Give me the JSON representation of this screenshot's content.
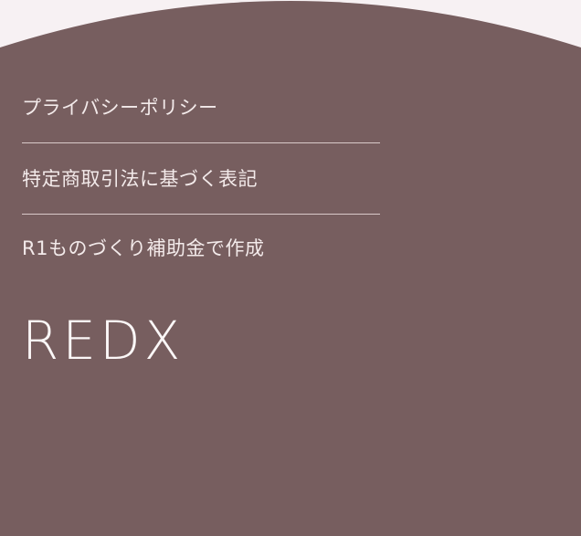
{
  "footer": {
    "links": [
      {
        "label": "プライバシーポリシー"
      },
      {
        "label": "特定商取引法に基づく表記"
      },
      {
        "label": "R1ものづくり補助金で作成"
      }
    ],
    "logo_text": "REDX"
  },
  "colors": {
    "page_background": "#f7f1f3",
    "footer_background": "#775e5f",
    "text": "#f3eaea",
    "divider": "#d9c9c9"
  }
}
